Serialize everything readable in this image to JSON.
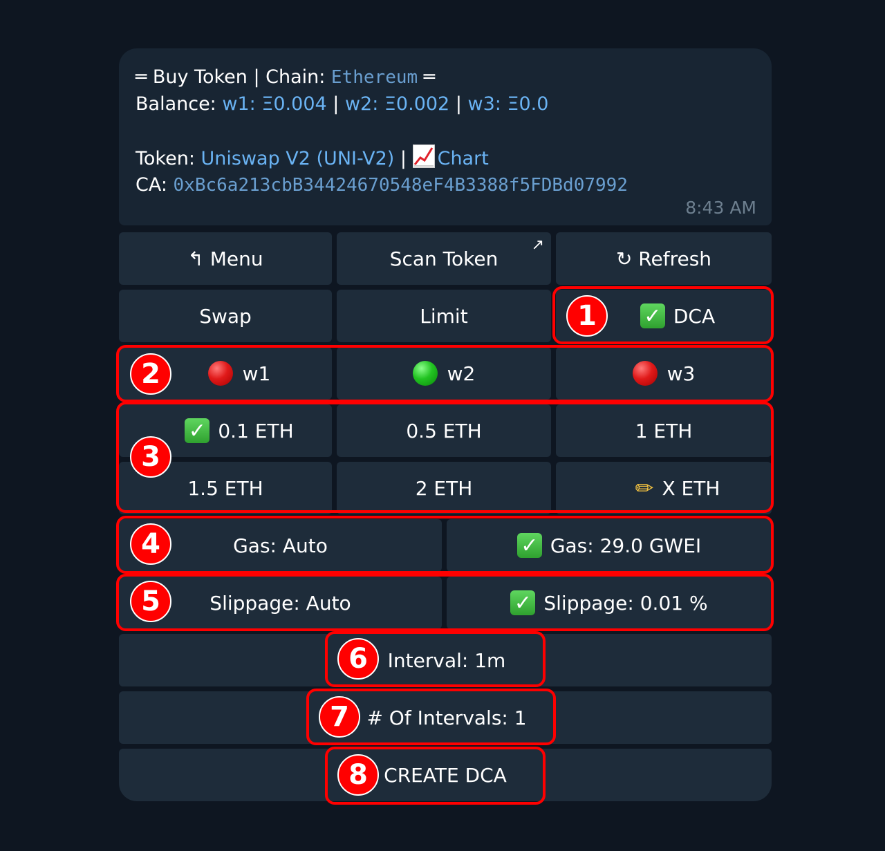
{
  "message": {
    "title_prefix": "═ Buy Token | Chain: ",
    "chain": "Ethereum",
    "title_suffix": " ═",
    "balance_label": "Balance: ",
    "w1": "w1: Ξ0.004",
    "w2": "w2: Ξ0.002",
    "w3": "w3: Ξ0.0",
    "sep": " | ",
    "token_label": "Token: ",
    "token": "Uniswap V2 (UNI-V2)",
    "chart": "Chart",
    "ca_label": "CA: ",
    "ca": "0xBc6a213cbB34424670548eF4B3388f5FDBd07992",
    "time": "8:43 AM"
  },
  "buttons": {
    "menu": "↰ Menu",
    "scan": "Scan Token",
    "scan_arrow": "↗",
    "refresh": "↻ Refresh",
    "swap": "Swap",
    "limit": "Limit",
    "dca": "DCA",
    "w1": "w1",
    "w2": "w2",
    "w3": "w3",
    "amt1": "0.1 ETH",
    "amt2": "0.5 ETH",
    "amt3": "1 ETH",
    "amt4": "1.5 ETH",
    "amt5": "2 ETH",
    "amt6": "X ETH",
    "gas_auto": "Gas: Auto",
    "gas_set": "Gas: 29.0 GWEI",
    "slip_auto": "Slippage: Auto",
    "slip_set": "Slippage: 0.01 %",
    "interval": "Interval: 1m",
    "num_intervals": "# Of Intervals: 1",
    "create": "CREATE DCA"
  },
  "badges": [
    "1",
    "2",
    "3",
    "4",
    "5",
    "6",
    "7",
    "8"
  ],
  "wallet_status": {
    "w1": "red",
    "w2": "green",
    "w3": "red"
  },
  "colors": {
    "highlight": "#ff0000",
    "link": "#6ab3f3",
    "button_bg": "#1e2c3a",
    "bg": "#0e1621"
  }
}
